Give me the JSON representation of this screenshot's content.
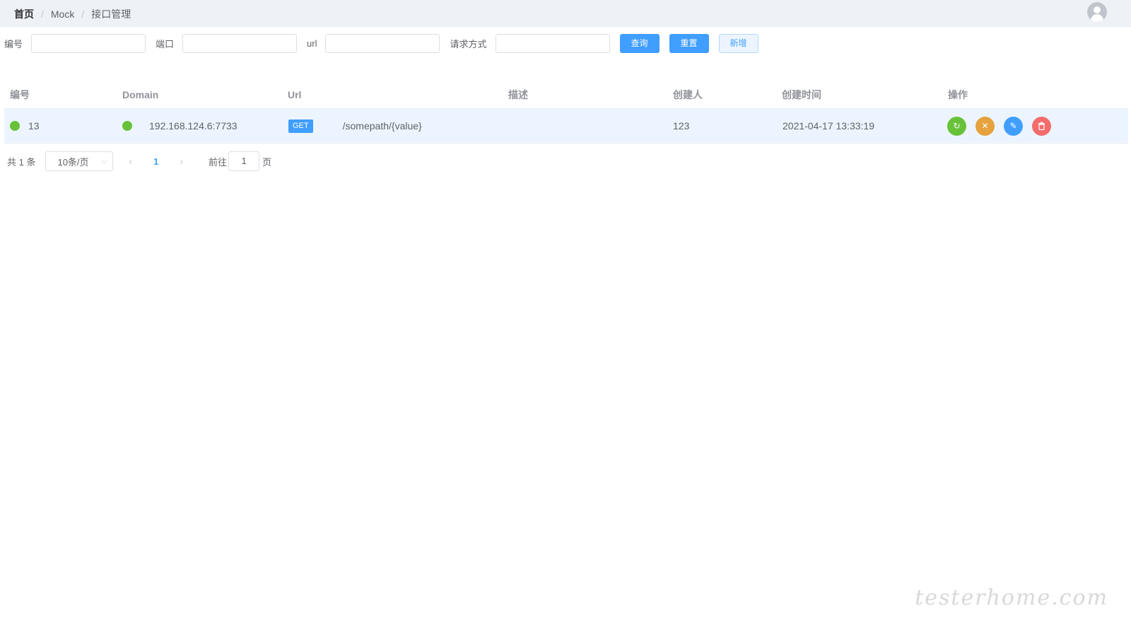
{
  "breadcrumb": {
    "home": "首页",
    "sep": "/",
    "section": "Mock",
    "current": "接口管理"
  },
  "header": {
    "avatar_icon": "user-avatar-icon"
  },
  "filters": {
    "id_label": "编号",
    "port_label": "端口",
    "url_label": "url",
    "method_label": "请求方式",
    "id_value": "",
    "port_value": "",
    "url_value": "",
    "method_value": "",
    "query_button": "查询",
    "reset_button": "重置",
    "add_button": "新增"
  },
  "table": {
    "columns": [
      "编号",
      "Domain",
      "Url",
      "描述",
      "创建人",
      "创建时间",
      "操作"
    ],
    "rows": [
      {
        "id": "13",
        "domain": "192.168.124.6:7733",
        "method": "GET",
        "url": "/somepath/{value}",
        "desc": "",
        "creator": "123",
        "created_at": "2021-04-17 13:33:19",
        "actions": [
          "refresh-icon",
          "close-icon",
          "edit-icon",
          "delete-icon"
        ]
      }
    ]
  },
  "pagination": {
    "total": "共 1 条",
    "page_size": "10条/页",
    "current_page": "1",
    "goto_label": "前往",
    "goto_value": "1",
    "page_suffix": "页"
  },
  "watermark": "testerhome.com",
  "colors": {
    "primary": "#409eff",
    "success": "#67c23a",
    "warning": "#e6a23c",
    "danger": "#f56c6c"
  }
}
